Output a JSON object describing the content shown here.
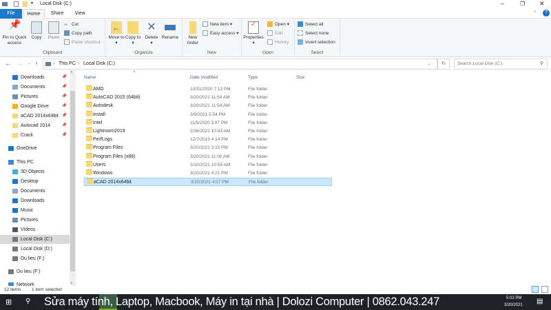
{
  "window": {
    "title": "Local Disk (C:)",
    "controls": [
      "minimize",
      "restore",
      "close"
    ]
  },
  "tabs": [
    {
      "label": "File",
      "active": false,
      "accent": "#1979ca"
    },
    {
      "label": "Home",
      "active": true
    },
    {
      "label": "Share"
    },
    {
      "label": "View"
    }
  ],
  "ribbon": {
    "clipboard": {
      "label": "Clipboard",
      "pin": "Pin to Quick access",
      "copy": "Copy",
      "paste": "Paste",
      "cut": "Cut",
      "copy_path": "Copy path",
      "paste_shortcut": "Paste shortcut"
    },
    "organize": {
      "label": "Organize",
      "move_to": "Move to",
      "copy_to": "Copy to",
      "delete": "Delete",
      "rename": "Rename"
    },
    "new": {
      "label": "New",
      "new_folder": "New folder",
      "new_item": "New item",
      "easy_access": "Easy access"
    },
    "open": {
      "label": "Open",
      "properties": "Properties",
      "open": "Open",
      "edit": "Edit",
      "history": "History"
    },
    "select": {
      "label": "Select",
      "select_all": "Select all",
      "select_none": "Select none",
      "invert": "Invert selection"
    }
  },
  "address": {
    "crumbs": [
      "This PC",
      "Local Disk (C:)"
    ],
    "search_placeholder": "Search Local Disk (C:)"
  },
  "nav": {
    "items": [
      {
        "label": "Downloads",
        "pinned": true,
        "icon": "download-icon"
      },
      {
        "label": "Documents",
        "pinned": true,
        "icon": "document-icon"
      },
      {
        "label": "Pictures",
        "pinned": true,
        "icon": "pictures-icon"
      },
      {
        "label": "Google Drive",
        "pinned": true,
        "icon": "google-drive-icon"
      },
      {
        "label": "aCAD 2014x64bit",
        "pinned": true,
        "icon": "folder-icon"
      },
      {
        "label": "Autocad 2014",
        "pinned": true,
        "icon": "folder-icon"
      },
      {
        "label": "Crack",
        "pinned": true,
        "icon": "folder-icon"
      },
      {
        "label": "OneDrive",
        "icon": "cloud-icon"
      },
      {
        "label": "This PC",
        "icon": "pc-icon"
      },
      {
        "label": "3D Objects",
        "icon": "cube-icon"
      },
      {
        "label": "Desktop",
        "icon": "desktop-icon"
      },
      {
        "label": "Documents",
        "icon": "document-icon"
      },
      {
        "label": "Downloads",
        "icon": "download-icon"
      },
      {
        "label": "Music",
        "icon": "music-icon"
      },
      {
        "label": "Pictures",
        "icon": "pictures-icon"
      },
      {
        "label": "Videos",
        "icon": "video-icon"
      },
      {
        "label": "Local Disk (C:)",
        "icon": "drive-icon",
        "selected": true
      },
      {
        "label": "Local Disk (D:)",
        "icon": "drive-icon"
      },
      {
        "label": "Du lieu (F:)",
        "icon": "drive-icon"
      },
      {
        "label": "Du lieu (F:)",
        "icon": "drive-icon"
      },
      {
        "label": "Network",
        "icon": "network-icon"
      }
    ]
  },
  "columns": [
    "Name",
    "Date modified",
    "Type",
    "Size"
  ],
  "files": [
    {
      "name": "AMD",
      "date": "10/31/2020 7:13 PM",
      "type": "File folder"
    },
    {
      "name": "AutoCAD 2015 (64bit)",
      "date": "3/20/2021 11:54 AM",
      "type": "File folder"
    },
    {
      "name": "Autodesk",
      "date": "3/20/2021 11:54 AM",
      "type": "File folder"
    },
    {
      "name": "install",
      "date": "3/9/2021 5:54 PM",
      "type": "File folder"
    },
    {
      "name": "Intel",
      "date": "11/5/2020 3:07 PM",
      "type": "File folder"
    },
    {
      "name": "Lightroom2019",
      "date": "2/26/2021 10:43 AM",
      "type": "File folder"
    },
    {
      "name": "PerfLogs",
      "date": "12/7/2019 4:14 PM",
      "type": "File folder"
    },
    {
      "name": "Program Files",
      "date": "3/20/2021 3:15 PM",
      "type": "File folder"
    },
    {
      "name": "Program Files (x86)",
      "date": "3/20/2021 11:00 AM",
      "type": "File folder"
    },
    {
      "name": "Users",
      "date": "3/10/2021 10:55 AM",
      "type": "File folder"
    },
    {
      "name": "Windows",
      "date": "3/20/2021 4:21 PM",
      "type": "File folder"
    },
    {
      "name": "aCAD 2014x64bit",
      "date": "3/20/2021 4:57 PM",
      "type": "File folder",
      "selected": true
    }
  ],
  "status": {
    "count": "12 items",
    "selected": "1 item selected"
  },
  "taskbar": {
    "overlay": "Sửa máy tính, Laptop, Macbook, Máy in tại nhà | Dolozi Computer | 0862.043.247",
    "time": "5:02 PM",
    "date": "3/20/2021",
    "notifications": "3"
  }
}
